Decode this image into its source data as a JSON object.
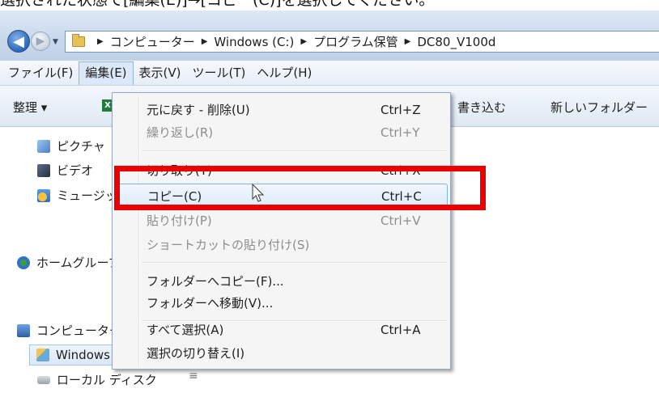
{
  "caption": "選択された状態で[編集(E)]→[コピー(C)]を選択してください。",
  "address": {
    "crumbs": [
      "コンピューター",
      "Windows (C:)",
      "プログラム保管",
      "DC80_V100d"
    ]
  },
  "menubar": {
    "items": [
      "ファイル(F)",
      "編集(E)",
      "表示(V)",
      "ツール(T)",
      "ヘルプ(H)"
    ]
  },
  "toolbar": {
    "organize": "整理 ▾",
    "burn": "書き込む",
    "new_folder": "新しいフォルダー"
  },
  "nav": {
    "items": [
      "ピクチャ",
      "ビデオ",
      "ミュージック",
      "ホームグループ",
      "コンピューター",
      "Windows (C:)",
      "ローカル ディスク"
    ]
  },
  "edit_menu": {
    "items": [
      {
        "label": "元に戻す - 削除(U)",
        "shortcut": "Ctrl+Z",
        "enabled": true
      },
      {
        "label": "繰り返し(R)",
        "shortcut": "Ctrl+Y",
        "enabled": false
      },
      {
        "label": "切り取り(T)",
        "shortcut": "Ctrl+X",
        "enabled": true
      },
      {
        "label": "コピー(C)",
        "shortcut": "Ctrl+C",
        "enabled": true
      },
      {
        "label": "貼り付け(P)",
        "shortcut": "Ctrl+V",
        "enabled": false
      },
      {
        "label": "ショートカットの貼り付け(S)",
        "shortcut": "",
        "enabled": false
      },
      {
        "label": "フォルダーへコピー(F)...",
        "shortcut": "",
        "enabled": true
      },
      {
        "label": "フォルダーへ移動(V)...",
        "shortcut": "",
        "enabled": true
      },
      {
        "label": "すべて選択(A)",
        "shortcut": "Ctrl+A",
        "enabled": true
      },
      {
        "label": "選択の切り替え(I)",
        "shortcut": "",
        "enabled": true
      }
    ]
  },
  "colors": {
    "highlight_box": "#ea0000",
    "menu_hover": "#dcebfc"
  }
}
